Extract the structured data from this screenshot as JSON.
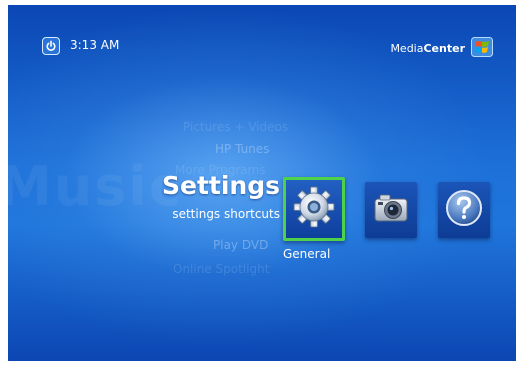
{
  "header": {
    "time": "3:13 AM",
    "brand_prefix": "Media",
    "brand_suffix": "Center"
  },
  "menu": {
    "ghost_items_above": [
      "Pictures + Videos",
      "HP Tunes",
      "More Programs"
    ],
    "current_section": {
      "title": "Settings",
      "subtitle": "settings shortcuts"
    },
    "ghost_items_below": [
      "Play DVD",
      "Online Spotlight"
    ],
    "ghost_background_word": "Music"
  },
  "tiles": [
    {
      "label": "General",
      "icon": "gear-icon",
      "selected": true
    },
    {
      "label": "",
      "icon": "camera-icon",
      "selected": false
    },
    {
      "label": "",
      "icon": "help-icon",
      "selected": false
    }
  ],
  "selected_tile_label": "General",
  "colors": {
    "background_top": "#0b47b4",
    "background_mid": "#1f75db",
    "selection_border": "#4ed14b",
    "text": "#ffffff"
  }
}
